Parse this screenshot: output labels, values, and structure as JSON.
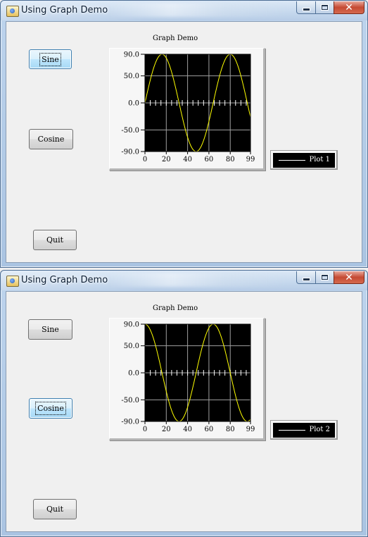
{
  "windows": [
    {
      "title": "Using Graph Demo",
      "buttons": {
        "sine": "Sine",
        "cosine": "Cosine",
        "quit": "Quit"
      },
      "focused_button": "sine",
      "graph": {
        "title": "Graph Demo",
        "legend_label": "Plot 1"
      },
      "chart_data": {
        "type": "line",
        "title": "Graph Demo",
        "xlabel": "",
        "ylabel": "",
        "x_range": [
          0,
          99
        ],
        "ylim": [
          -90,
          90
        ],
        "x_ticks": [
          "0",
          "20",
          "40",
          "60",
          "80",
          "99"
        ],
        "y_ticks": [
          "90.0",
          "50.0",
          "0.0",
          "-50.0",
          "-90.0"
        ],
        "series": [
          {
            "name": "Plot 1",
            "function": "90*sin(2*pi*x/64)",
            "x": [
              0,
              16,
              32,
              48,
              64,
              80,
              96,
              99
            ],
            "values": [
              0,
              90,
              0,
              -90,
              0,
              90,
              0,
              -26
            ],
            "color": "#ffff00"
          }
        ],
        "grid": true,
        "legend_position": "right"
      }
    },
    {
      "title": "Using Graph Demo",
      "buttons": {
        "sine": "Sine",
        "cosine": "Cosine",
        "quit": "Quit"
      },
      "focused_button": "cosine",
      "graph": {
        "title": "Graph Demo",
        "legend_label": "Plot 2"
      },
      "chart_data": {
        "type": "line",
        "title": "Graph Demo",
        "xlabel": "",
        "ylabel": "",
        "x_range": [
          0,
          99
        ],
        "ylim": [
          -90,
          90
        ],
        "x_ticks": [
          "0",
          "20",
          "40",
          "60",
          "80",
          "99"
        ],
        "y_ticks": [
          "90.0",
          "50.0",
          "0.0",
          "-50.0",
          "-90.0"
        ],
        "series": [
          {
            "name": "Plot 2",
            "function": "90*cos(2*pi*x/64)",
            "x": [
              0,
              16,
              32,
              48,
              64,
              80,
              96,
              99
            ],
            "values": [
              90,
              0,
              -90,
              0,
              90,
              0,
              -90,
              -86
            ],
            "color": "#ffff00"
          }
        ],
        "grid": true,
        "legend_position": "right"
      }
    }
  ],
  "colors": {
    "plot_background": "#000000",
    "plot_line": "#ffff00",
    "grid": "#a0a0a0"
  },
  "titlebar_icons": [
    "app-icon",
    "minimize-icon",
    "maximize-icon",
    "close-icon"
  ]
}
